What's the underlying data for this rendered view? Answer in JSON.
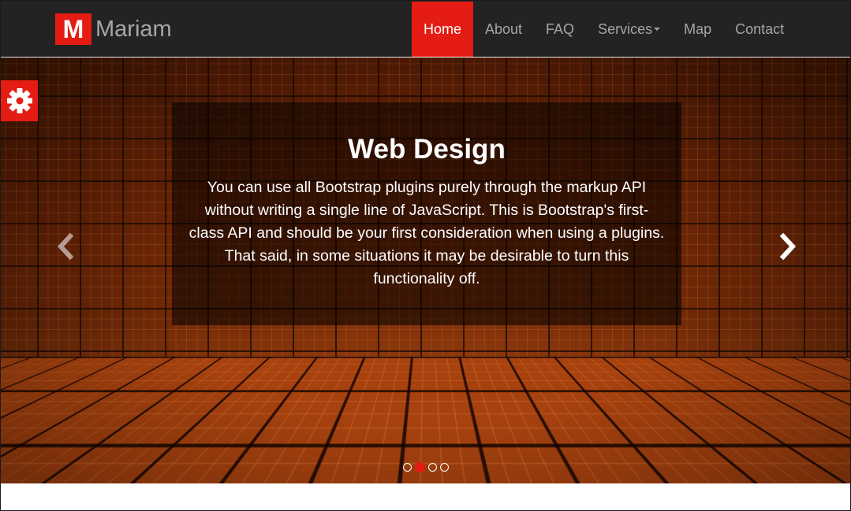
{
  "brand": {
    "logo_letter": "M",
    "name": "Mariam"
  },
  "nav": {
    "items": [
      {
        "label": "Home",
        "active": true
      },
      {
        "label": "About"
      },
      {
        "label": "FAQ"
      },
      {
        "label": "Services"
      },
      {
        "label": "Map"
      },
      {
        "label": "Contact"
      }
    ]
  },
  "carousel": {
    "title": "Web Design",
    "text": "You can use all Bootstrap plugins purely through the markup API without writing a single line of JavaScript. This is Bootstrap's first-class API and should be your first consideration when using a plugins. That said, in some situations it may be desirable to turn this functionality off.",
    "slide_count": 4,
    "active_slide": 2,
    "prev_icon": "chevron-left-icon",
    "next_icon": "chevron-right-icon"
  },
  "settings": {
    "icon": "gear-icon"
  },
  "colors": {
    "accent": "#e41c13",
    "navbar_bg": "#232323",
    "nav_text": "#a5a5a5"
  }
}
